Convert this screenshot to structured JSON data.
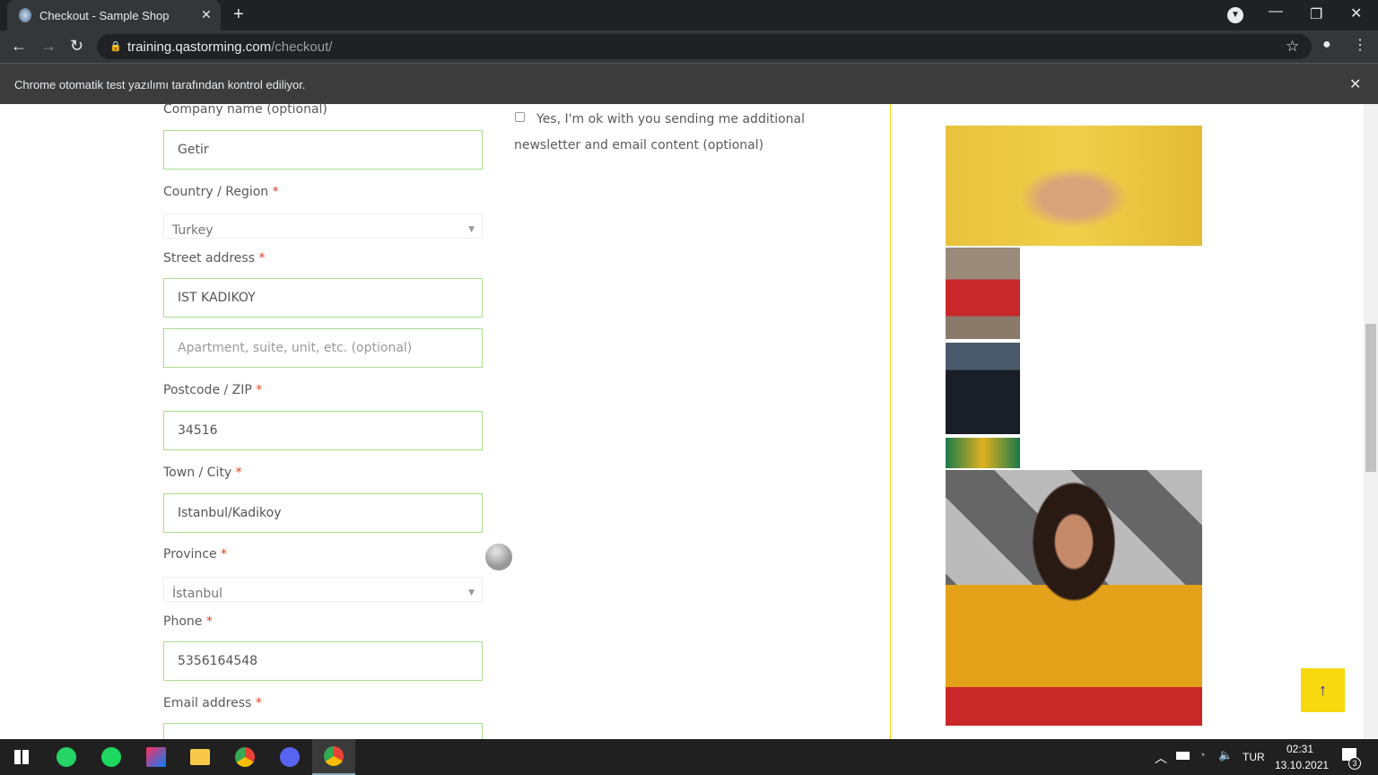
{
  "browser": {
    "tab_title": "Checkout - Sample Shop",
    "url_host": "training.qastorming.com",
    "url_path": "/checkout/",
    "infobar": "Chrome otomatik test yazılımı tarafından kontrol ediliyor."
  },
  "form": {
    "company_label": "Company name (optional)",
    "company_value": "Getir",
    "country_label": "Country / Region",
    "country_value": "Turkey",
    "street_label": "Street address",
    "street_value": "IST KADIKOY",
    "apartment_placeholder": "Apartment, suite, unit, etc. (optional)",
    "postcode_label": "Postcode / ZIP",
    "postcode_value": "34516",
    "city_label": "Town / City",
    "city_value": "Istanbul/Kadikoy",
    "province_label": "Province",
    "province_value": "İstanbul",
    "phone_label": "Phone",
    "phone_value": "5356164548",
    "email_label": "Email address",
    "required": "*"
  },
  "newsletter": {
    "label": "Yes, I'm ok with you sending me additional newsletter and email content (optional)",
    "checked": false
  },
  "taskbar": {
    "lang": "TUR",
    "time": "02:31",
    "date": "13.10.2021",
    "notifications": "3"
  },
  "colors": {
    "accent": "#f7d90f",
    "input_border": "#a8df8e",
    "required": "#e2401c"
  }
}
